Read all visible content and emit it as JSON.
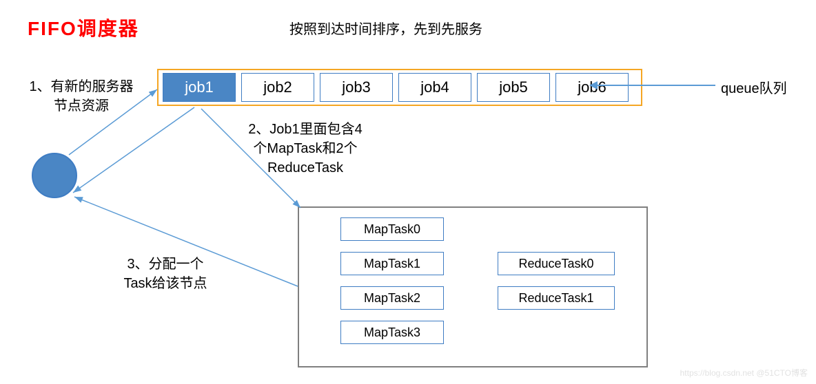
{
  "title": "FIFO调度器",
  "subtitle": "按照到达时间排序，先到先服务",
  "queue": {
    "label": "queue队列",
    "jobs": [
      {
        "label": "job1",
        "active": true
      },
      {
        "label": "job2",
        "active": false
      },
      {
        "label": "job3",
        "active": false
      },
      {
        "label": "job4",
        "active": false
      },
      {
        "label": "job5",
        "active": false
      },
      {
        "label": "job6",
        "active": false
      }
    ]
  },
  "notes": {
    "n1a": "1、有新的服务器",
    "n1b": "节点资源",
    "n2a": "2、Job1里面包含4",
    "n2b": "个MapTask和2个",
    "n2c": "ReduceTask",
    "n3a": "3、分配一个",
    "n3b": "Task给该节点"
  },
  "tasks": {
    "map": [
      "MapTask0",
      "MapTask1",
      "MapTask2",
      "MapTask3"
    ],
    "reduce": [
      "ReduceTask0",
      "ReduceTask1"
    ]
  },
  "watermark": "https://blog.csdn.net @51CTO博客"
}
